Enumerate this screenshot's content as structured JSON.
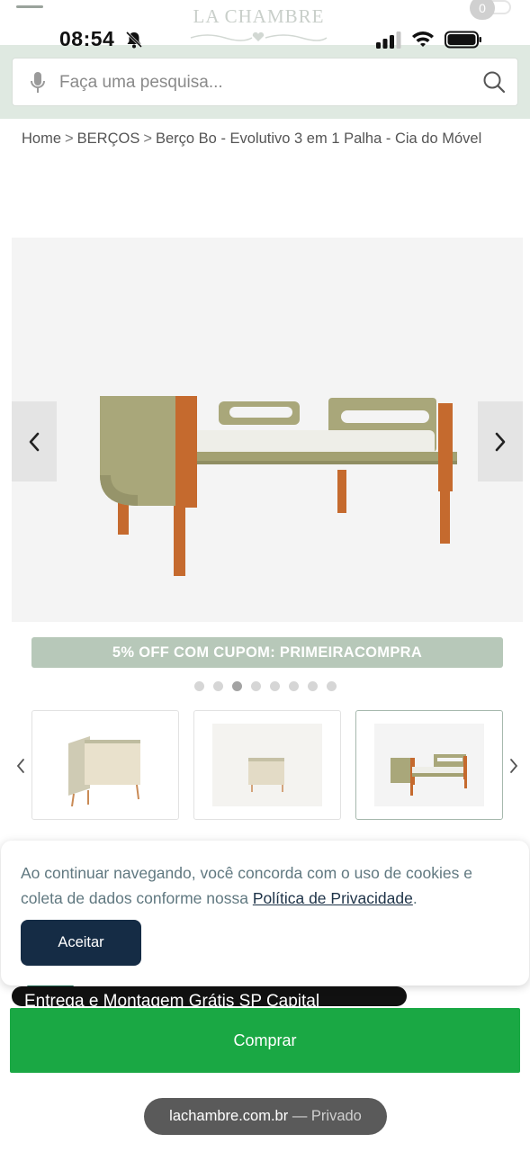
{
  "status_bar": {
    "time": "08:54",
    "icons": [
      "bell-slash-icon",
      "signal-icon",
      "wifi-icon",
      "battery-icon"
    ]
  },
  "header": {
    "logo_text": "LA CHAMBRE",
    "cart_count": "0",
    "icons": [
      "menu-icon",
      "cart-icon"
    ]
  },
  "search": {
    "placeholder": "Faça uma pesquisa...",
    "value": "",
    "icons": [
      "mic-icon",
      "search-icon"
    ]
  },
  "breadcrumb": {
    "items": [
      "Home",
      "BERÇOS",
      "Berço Bo - Evolutivo 3 em 1 Palha - Cia do Móvel"
    ],
    "separator": ">"
  },
  "product": {
    "image_description": "bed-image",
    "coupon": "5% OFF COM CUPOM: PRIMEIRACOMPRA",
    "carousel": {
      "dot_count": 8,
      "active_dot": 3
    },
    "thumbnails": [
      "crib-thumbnail",
      "mini-crib-thumbnail",
      "toddler-bed-thumbnail"
    ],
    "active_thumbnail": 3
  },
  "cookie_banner": {
    "text": "Ao continuar navegando, você concorda com o uso de cookies e coleta de dados conforme nossa",
    "link": "Política de Privacidade",
    "trailing": ".",
    "accept_label": "Aceitar"
  },
  "shipping_peek": "Entrega e Montagem Grátis SP Capital",
  "buy": {
    "label": "Comprar"
  },
  "browser": {
    "domain": "lachambre.com.br",
    "mode": "— Privado"
  },
  "colors": {
    "header_bg": "#dfe9e1",
    "coupon_bg": "#b7c8b9",
    "accept_bg": "#152c45",
    "buy_bg": "#1aa844",
    "bed_frame": "#a9a77a",
    "wood": "#c56a2e"
  }
}
